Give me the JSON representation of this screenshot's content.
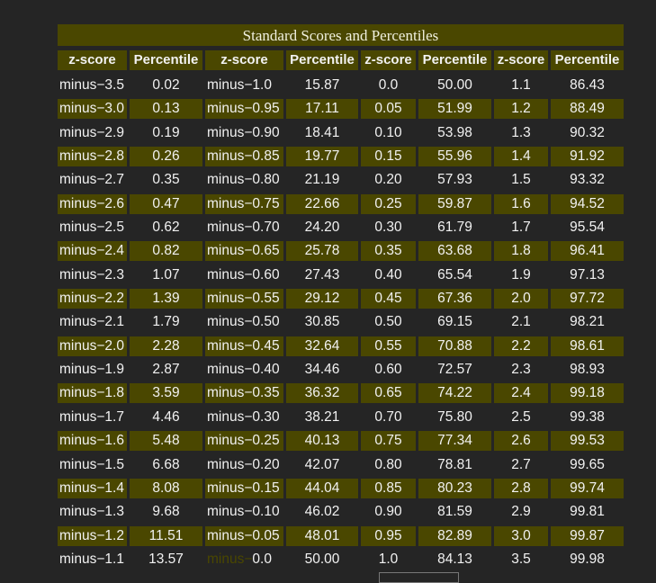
{
  "title": "Standard Scores and Percentiles",
  "headers": [
    "z-score",
    "Percentile",
    "z-score",
    "Percentile",
    "z-score",
    "Percentile",
    "z-score",
    "Percentile"
  ],
  "rows": [
    [
      "minus−3.5",
      "0.02",
      "minus−1.0",
      "15.87",
      "0.0",
      "50.00",
      "1.1",
      "86.43"
    ],
    [
      "minus−3.0",
      "0.13",
      "minus−0.95",
      "17.11",
      "0.05",
      "51.99",
      "1.2",
      "88.49"
    ],
    [
      "minus−2.9",
      "0.19",
      "minus−0.90",
      "18.41",
      "0.10",
      "53.98",
      "1.3",
      "90.32"
    ],
    [
      "minus−2.8",
      "0.26",
      "minus−0.85",
      "19.77",
      "0.15",
      "55.96",
      "1.4",
      "91.92"
    ],
    [
      "minus−2.7",
      "0.35",
      "minus−0.80",
      "21.19",
      "0.20",
      "57.93",
      "1.5",
      "93.32"
    ],
    [
      "minus−2.6",
      "0.47",
      "minus−0.75",
      "22.66",
      "0.25",
      "59.87",
      "1.6",
      "94.52"
    ],
    [
      "minus−2.5",
      "0.62",
      "minus−0.70",
      "24.20",
      "0.30",
      "61.79",
      "1.7",
      "95.54"
    ],
    [
      "minus−2.4",
      "0.82",
      "minus−0.65",
      "25.78",
      "0.35",
      "63.68",
      "1.8",
      "96.41"
    ],
    [
      "minus−2.3",
      "1.07",
      "minus−0.60",
      "27.43",
      "0.40",
      "65.54",
      "1.9",
      "97.13"
    ],
    [
      "minus−2.2",
      "1.39",
      "minus−0.55",
      "29.12",
      "0.45",
      "67.36",
      "2.0",
      "97.72"
    ],
    [
      "minus−2.1",
      "1.79",
      "minus−0.50",
      "30.85",
      "0.50",
      "69.15",
      "2.1",
      "98.21"
    ],
    [
      "minus−2.0",
      "2.28",
      "minus−0.45",
      "32.64",
      "0.55",
      "70.88",
      "2.2",
      "98.61"
    ],
    [
      "minus−1.9",
      "2.87",
      "minus−0.40",
      "34.46",
      "0.60",
      "72.57",
      "2.3",
      "98.93"
    ],
    [
      "minus−1.8",
      "3.59",
      "minus−0.35",
      "36.32",
      "0.65",
      "74.22",
      "2.4",
      "99.18"
    ],
    [
      "minus−1.7",
      "4.46",
      "minus−0.30",
      "38.21",
      "0.70",
      "75.80",
      "2.5",
      "99.38"
    ],
    [
      "minus−1.6",
      "5.48",
      "minus−0.25",
      "40.13",
      "0.75",
      "77.34",
      "2.6",
      "99.53"
    ],
    [
      "minus−1.5",
      "6.68",
      "minus−0.20",
      "42.07",
      "0.80",
      "78.81",
      "2.7",
      "99.65"
    ],
    [
      "minus−1.4",
      "8.08",
      "minus−0.15",
      "44.04",
      "0.85",
      "80.23",
      "2.8",
      "99.74"
    ],
    [
      "minus−1.3",
      "9.68",
      "minus−0.10",
      "46.02",
      "0.90",
      "81.59",
      "2.9",
      "99.81"
    ],
    [
      "minus−1.2",
      "11.51",
      "minus−0.05",
      "48.01",
      "0.95",
      "82.89",
      "3.0",
      "99.87"
    ],
    [
      "minus−1.1",
      "13.57",
      "minus−0.0",
      "50.00",
      "1.0",
      "84.13",
      "3.5",
      "99.98"
    ]
  ],
  "colors": {
    "background": "#252525",
    "olive": "#4a4700",
    "text": "#f2f2f2"
  }
}
